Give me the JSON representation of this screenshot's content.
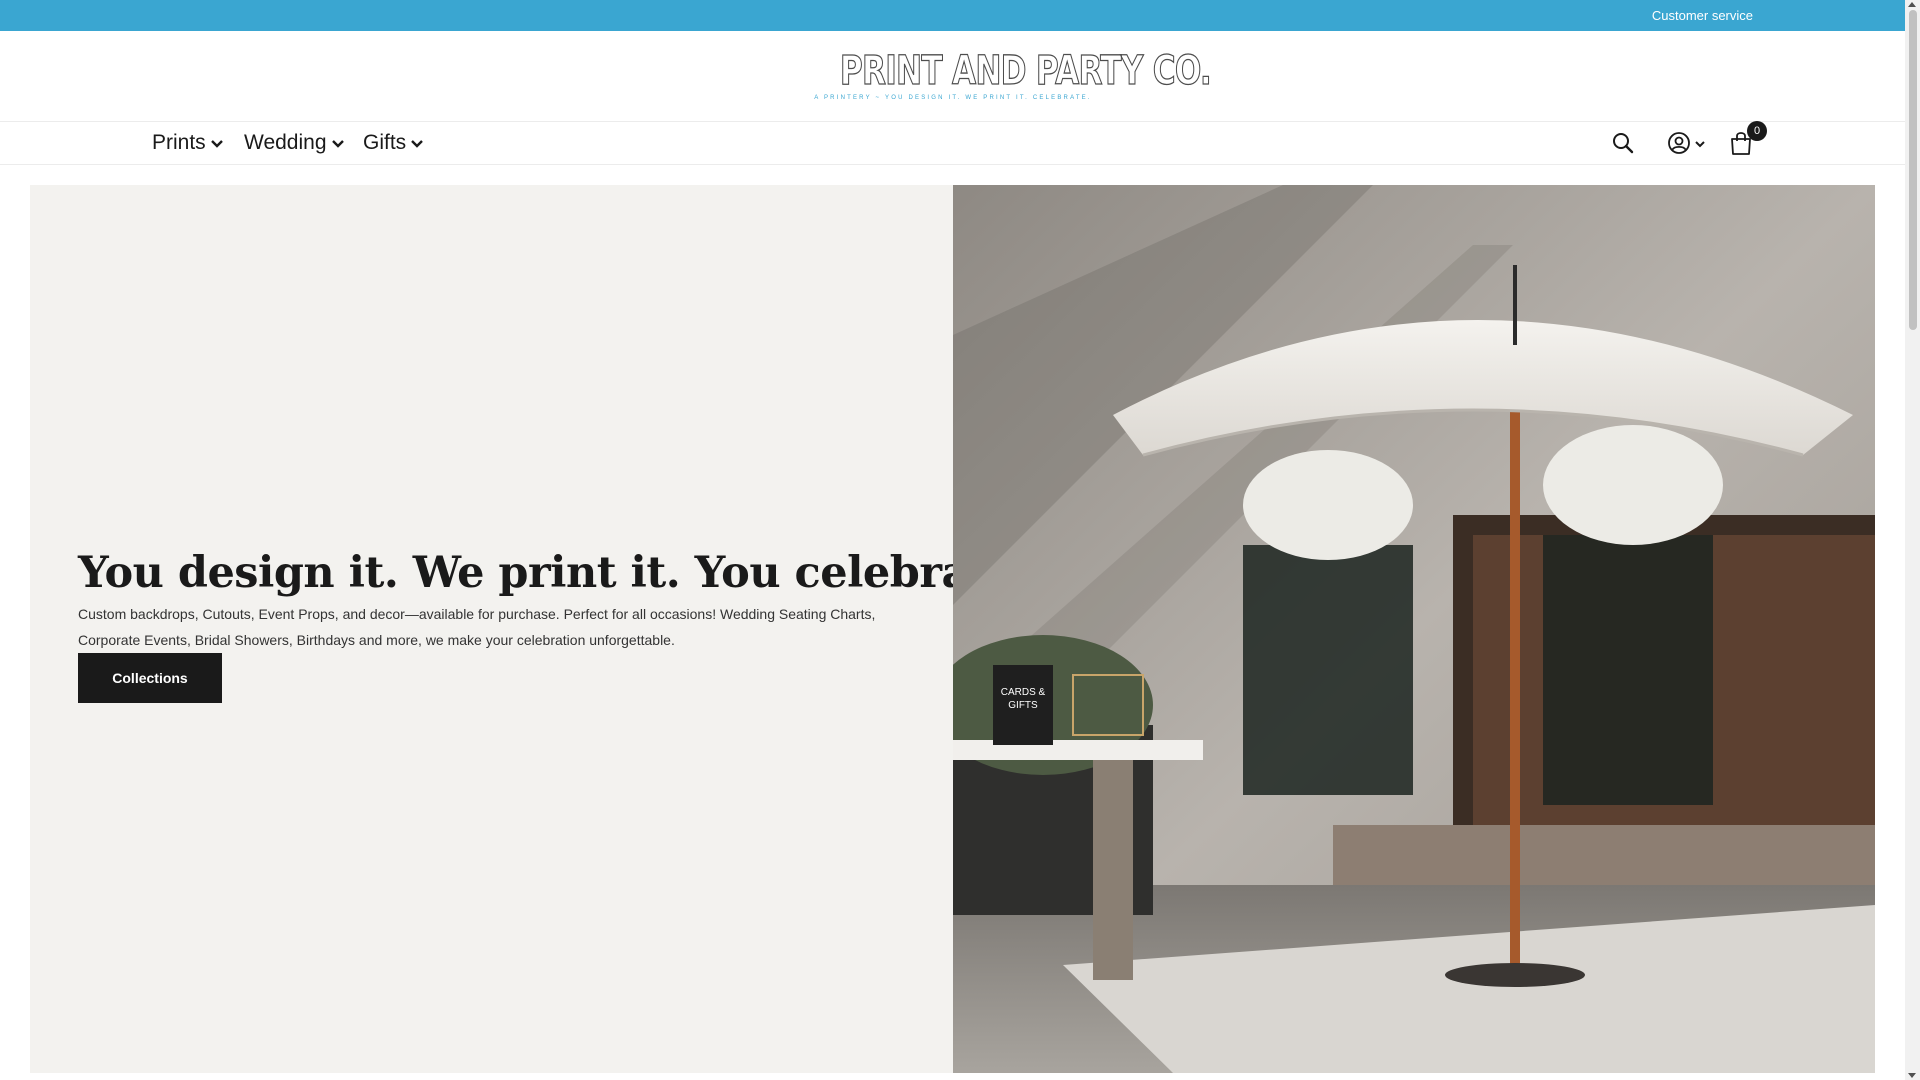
{
  "topbar": {
    "customer_service": "Customer service",
    "bg_color": "#3aa6d1"
  },
  "logo": {
    "wordmark": "PRINT AND PARTY CO.",
    "tagline": "A PRINTERY ~ YOU DESIGN IT. WE PRINT IT. CELEBRATE."
  },
  "nav": {
    "items": [
      {
        "label": "Prints",
        "icon": "chevron-down-icon"
      },
      {
        "label": "Wedding",
        "icon": "chevron-down-icon"
      },
      {
        "label": "Gifts",
        "icon": "chevron-down-icon"
      }
    ],
    "icons": [
      "search-icon",
      "account-icon",
      "chevron-down-icon",
      "cart-icon"
    ],
    "cart_count": "0"
  },
  "hero": {
    "title": "You design it. We print it. You celebrate.",
    "text": "Custom backdrops, Cutouts, Event Props, and decor—available for purchase. Perfect for all occasions! Wedding Seating Charts, Corporate Events, Bridal Showers, Birthdays and more, we make your celebration unforgettable.",
    "button_label": "Collections",
    "image_subject": "white patio umbrella with floral acrylic seating charts and cards & gifts table",
    "sign_text": "CARDS & GIFTS",
    "panel_color": "#f3f2ef"
  }
}
